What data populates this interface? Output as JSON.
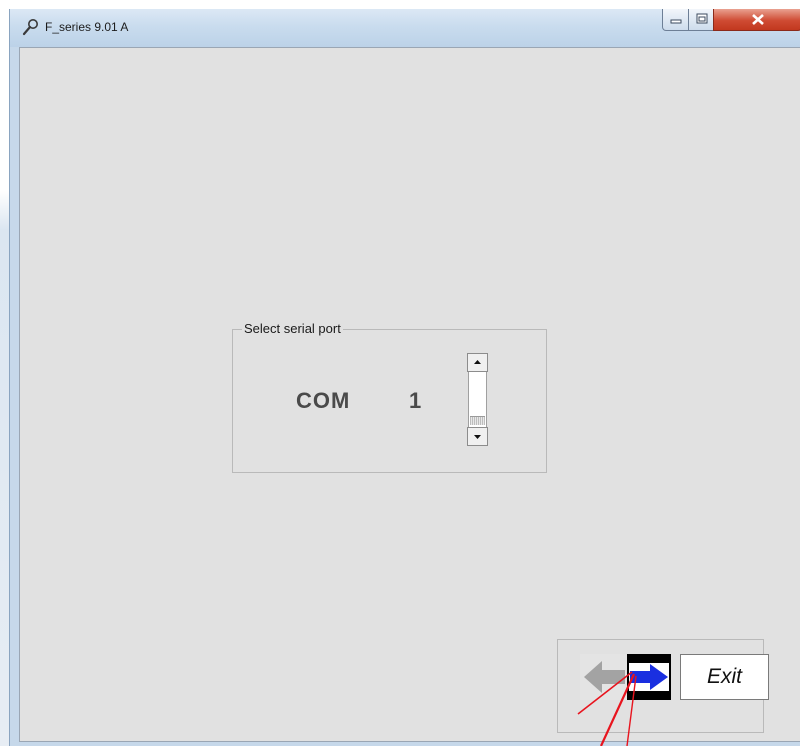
{
  "window": {
    "title": "F_series 9.01 A"
  },
  "serial_port": {
    "group_label": "Select serial port",
    "port_prefix": "COM",
    "port_number": "1"
  },
  "navigation": {
    "exit_label": "Exit"
  },
  "icons": {
    "app": "wrench-magnifier-icon",
    "minimize": "minimize-icon",
    "maximize": "maximize-icon",
    "close": "close-icon",
    "spin_up": "arrow-up-icon",
    "spin_down": "arrow-down-icon",
    "back": "arrow-left-icon",
    "next": "arrow-right-icon"
  },
  "colors": {
    "client_background": "#e1e1e1",
    "next_arrow": "#1a2fe0",
    "back_arrow": "#9a9a9a",
    "close_button": "#c8462e",
    "annotation": "#e8141e"
  }
}
